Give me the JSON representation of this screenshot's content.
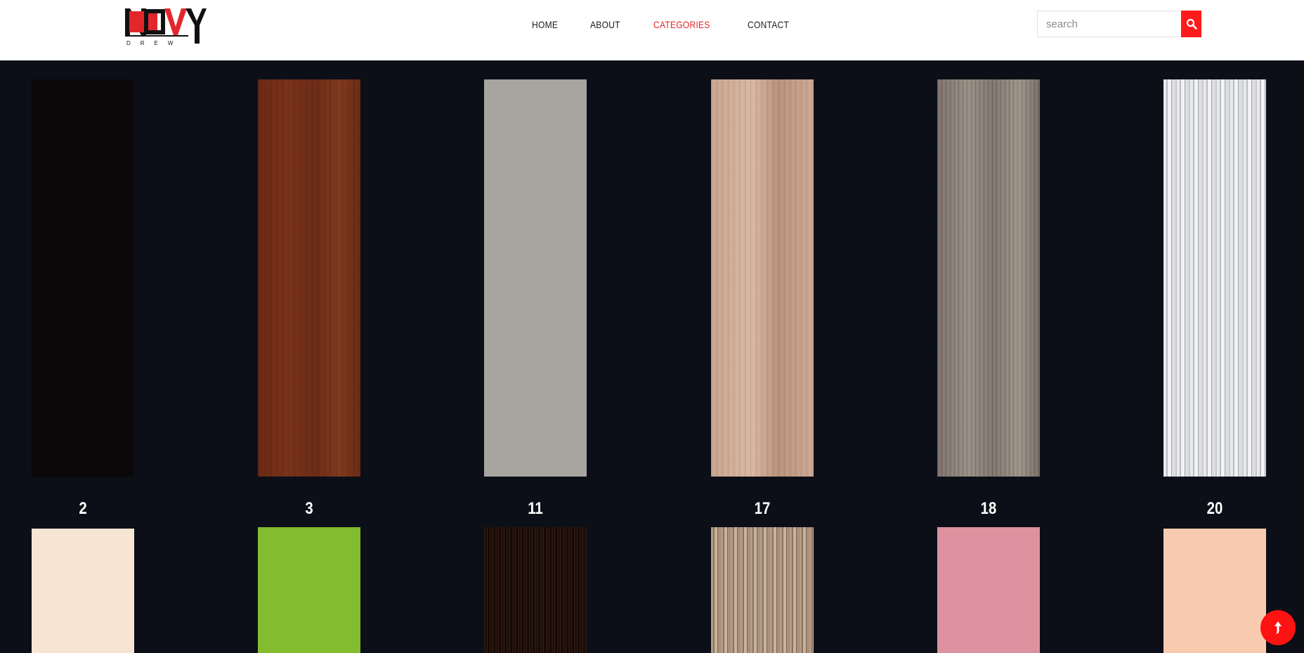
{
  "brand": {
    "name": "NOVY",
    "sub": "DREW"
  },
  "nav": [
    {
      "label": "HOME",
      "active": false
    },
    {
      "label": "ABOUT",
      "active": false
    },
    {
      "label": "CATEGORIES",
      "active": true
    },
    {
      "label": "CONTACT",
      "active": false
    }
  ],
  "search": {
    "placeholder": "search",
    "value": ""
  },
  "colors": {
    "accent": "#ff1b1b",
    "page_bg": "#0c0f17",
    "header_bg": "#ffffff"
  },
  "row1": [
    {
      "label": "2"
    },
    {
      "label": "3"
    },
    {
      "label": "11"
    },
    {
      "label": "17"
    },
    {
      "label": "18"
    },
    {
      "label": "20"
    }
  ],
  "row2": [
    {
      "label": ""
    },
    {
      "label": ""
    },
    {
      "label": ""
    },
    {
      "label": ""
    },
    {
      "label": ""
    },
    {
      "label": ""
    }
  ],
  "icons": {
    "search": "search-icon",
    "to_top": "arrow-up-icon"
  }
}
